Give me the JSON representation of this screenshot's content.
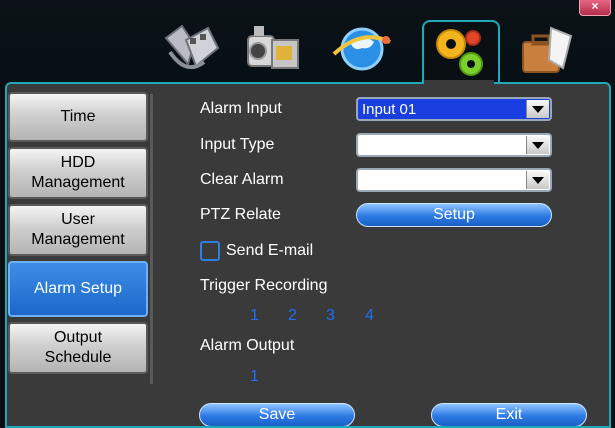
{
  "window": {
    "close_label": "×"
  },
  "toolbar_icons": [
    "video-playback-icon",
    "camera-icon",
    "network-globe-icon",
    "settings-gears-icon",
    "briefcase-tools-icon"
  ],
  "sidebar": {
    "items": [
      {
        "label": "Time",
        "active": false
      },
      {
        "label": "HDD Management",
        "line1": "HDD",
        "line2": "Management",
        "active": false
      },
      {
        "label": "User Management",
        "line1": "User",
        "line2": "Management",
        "active": false
      },
      {
        "label": "Alarm Setup",
        "active": true
      },
      {
        "label": "Output Schedule",
        "line1": "Output",
        "line2": "Schedule",
        "active": false
      }
    ]
  },
  "form": {
    "alarm_input": {
      "label": "Alarm Input",
      "value": "Input 01"
    },
    "input_type": {
      "label": "Input Type",
      "value": ""
    },
    "clear_alarm": {
      "label": "Clear Alarm",
      "value": ""
    },
    "ptz_relate": {
      "label": "PTZ Relate",
      "button": "Setup"
    },
    "send_email": {
      "label": "Send E-mail",
      "checked": false
    },
    "trigger_recording": {
      "label": "Trigger Recording",
      "channels": [
        "1",
        "2",
        "3",
        "4"
      ]
    },
    "alarm_output": {
      "label": "Alarm Output",
      "channels": [
        "1"
      ]
    }
  },
  "footer": {
    "save_label": "Save",
    "exit_label": "Exit"
  },
  "colors": {
    "accent": "#1fa8b8",
    "selected": "#1a3fe0",
    "channel": "#1f6ff0"
  }
}
